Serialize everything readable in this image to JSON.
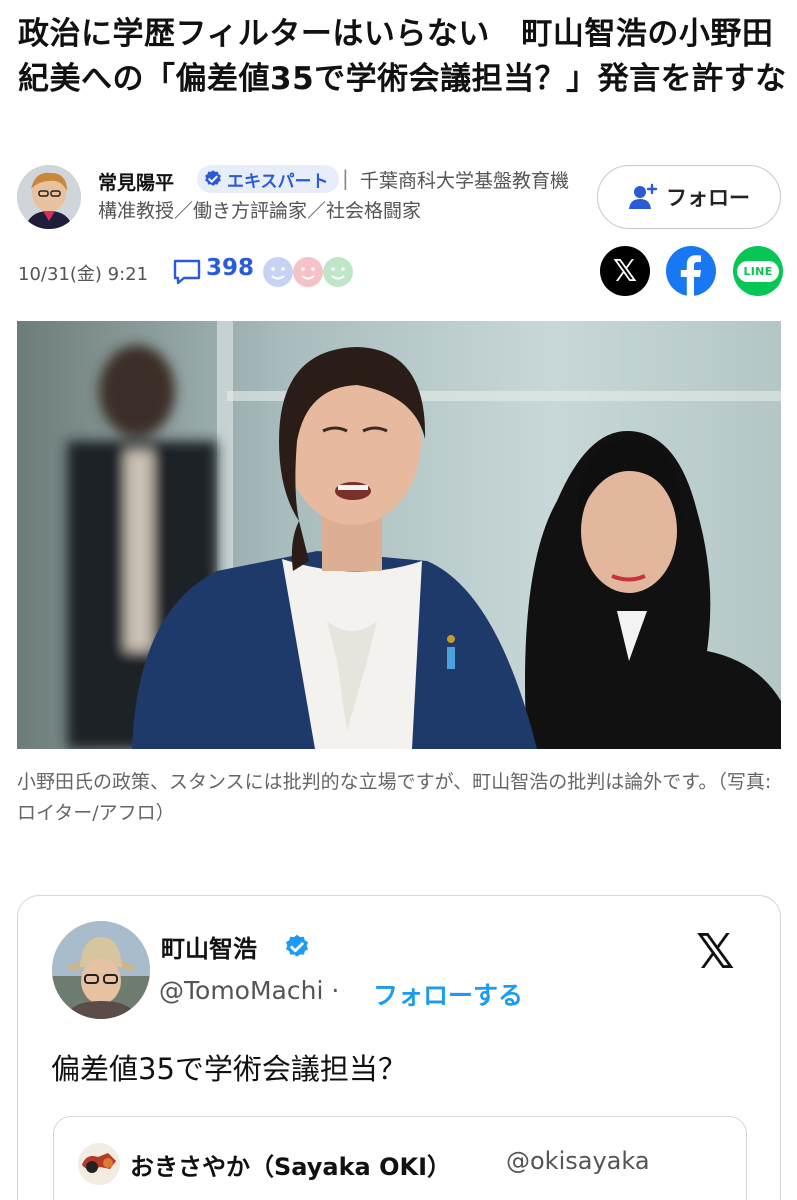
{
  "article": {
    "title": "政治に学歴フィルターはいらない　町山智浩の小野田紀美への「偏差値35で学術会議担当？」発言を許すな",
    "author": {
      "name": "常見陽平",
      "badge": "エキスパート",
      "title": "千葉商科大学基盤教育機構准教授／働き方評論家／社会格闘家",
      "separator": "|"
    },
    "follow_label": "フォロー",
    "date": "10/31(金) 9:21",
    "comment_count": "398",
    "share": {
      "x_label": "𝕏",
      "line_label": "LINE"
    },
    "photo_caption": "小野田氏の政策、スタンスには批判的な立場ですが、町山智浩の批判は論外です。（写真:ロイター/アフロ）"
  },
  "embedded_tweet": {
    "name": "町山智浩",
    "handle": "@TomoMachi",
    "separator": "·",
    "follow_label": "フォローする",
    "logo": "𝕏",
    "text": "偏差値35で学術会議担当？",
    "quoted": {
      "name": "おきさやか（Sayaka OKI）",
      "handle": "@okisayaka"
    }
  },
  "colors": {
    "accent_blue": "#2a5bd7",
    "twitter_blue": "#1d9bf0",
    "facebook_blue": "#1877f2",
    "line_green": "#06c755"
  },
  "icons": [
    "verified-check-icon",
    "add-user-icon",
    "comment-icon",
    "reaction-faces-icon",
    "x-logo-icon",
    "facebook-icon",
    "line-icon"
  ]
}
